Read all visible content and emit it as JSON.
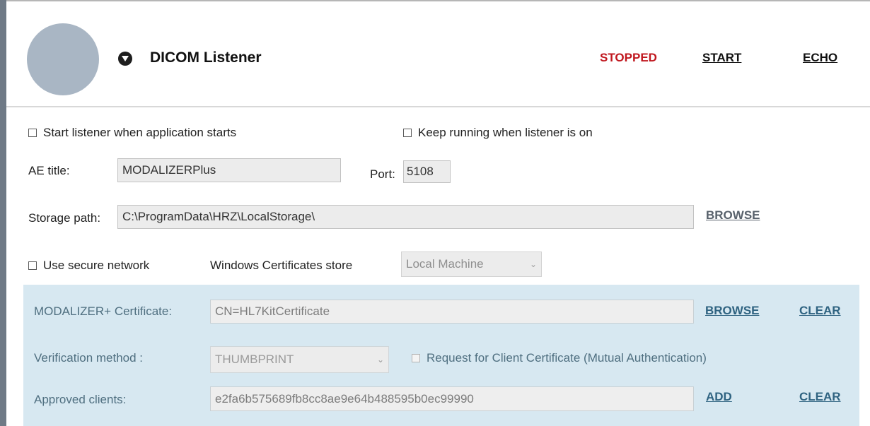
{
  "header": {
    "title": "DICOM Listener",
    "status": "STOPPED",
    "start_label": "START",
    "echo_label": "ECHO",
    "status_color": "#c0171e"
  },
  "options": {
    "start_with_app_label": "Start listener when application starts",
    "start_with_app_checked": false,
    "keep_running_label": "Keep running when listener is on",
    "keep_running_checked": false
  },
  "ae": {
    "label": "AE title:",
    "value": "MODALIZERPlus",
    "port_label": "Port:",
    "port_value": "5108"
  },
  "storage": {
    "label": "Storage path:",
    "value": "C:\\ProgramData\\HRZ\\LocalStorage\\",
    "browse_label": "BROWSE"
  },
  "secure": {
    "use_secure_label": "Use secure network",
    "use_secure_checked": false,
    "store_label": "Windows Certificates store",
    "store_value": "Local Machine"
  },
  "panel": {
    "background": "#d7e8f1",
    "cert_label": "MODALIZER+ Certificate:",
    "cert_value": "CN=HL7KitCertificate",
    "cert_browse": "BROWSE",
    "cert_clear": "CLEAR",
    "verify_label": "Verification method :",
    "verify_value": "THUMBPRINT",
    "mutual_label": "Request for Client Certificate (Mutual Authentication)",
    "mutual_checked": false,
    "approved_label": "Approved clients:",
    "approved_value": "e2fa6b575689fb8cc8ae9e64b488595b0ec99990",
    "add_label": "ADD",
    "approved_clear": "CLEAR"
  }
}
